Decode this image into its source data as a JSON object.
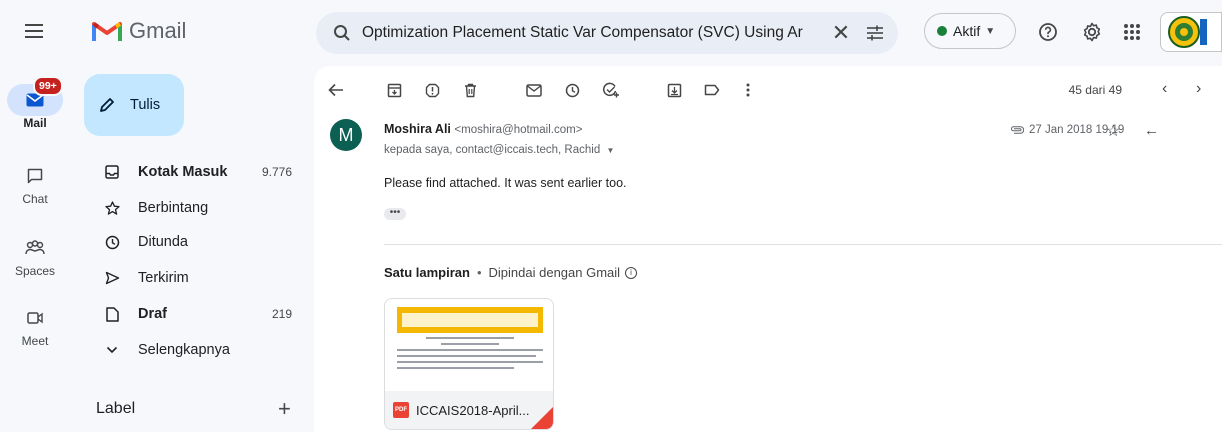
{
  "app": {
    "name": "Gmail",
    "brand_colors": [
      "#ea4335",
      "#4285f4",
      "#34a853",
      "#fbbc04",
      "#c5221f"
    ]
  },
  "search": {
    "value": "Optimization Placement Static Var Compensator (SVC) Using Ar",
    "clear_symbol": "✕"
  },
  "status": {
    "label": "Aktif",
    "color": "#188038"
  },
  "rail": {
    "items": [
      {
        "label": "Mail",
        "icon": "mail-icon",
        "badge": "99+",
        "active": true
      },
      {
        "label": "Chat",
        "icon": "chat-icon"
      },
      {
        "label": "Spaces",
        "icon": "spaces-icon"
      },
      {
        "label": "Meet",
        "icon": "meet-icon"
      }
    ]
  },
  "compose": {
    "label": "Tulis",
    "icon": "pencil-icon"
  },
  "sidebar": {
    "items": [
      {
        "label": "Kotak Masuk",
        "count": "9.776",
        "icon": "inbox-icon",
        "bold": true
      },
      {
        "label": "Berbintang",
        "count": "",
        "icon": "star-icon"
      },
      {
        "label": "Ditunda",
        "count": "",
        "icon": "clock-icon"
      },
      {
        "label": "Terkirim",
        "count": "",
        "icon": "send-icon"
      },
      {
        "label": "Draf",
        "count": "219",
        "icon": "draft-icon",
        "bold": true
      },
      {
        "label": "Selengkapnya",
        "count": "",
        "icon": "chevron-down-icon"
      }
    ],
    "labels_heading": "Label",
    "labels_add": "+"
  },
  "toolbar": {
    "icons": [
      "back-arrow-icon",
      "archive-icon",
      "report-spam-icon",
      "delete-icon",
      "mark-unread-icon",
      "snooze-icon",
      "add-task-icon",
      "move-to-icon",
      "label-icon",
      "more-vert-icon"
    ],
    "pager": "45 dari 49"
  },
  "email": {
    "avatar_letter": "M",
    "avatar_color": "#0b5f53",
    "sender_name": "Moshira Ali",
    "sender_email": "<moshira@hotmail.com>",
    "to": "kepada saya, contact@iccais.tech, Rachid",
    "date": "27 Jan 2018 19.19",
    "body": "Please find attached. It was sent earlier too.",
    "ellipsis": "•••"
  },
  "attachments": {
    "title": "Satu lampiran",
    "separator": "•",
    "note": "Dipindai dengan Gmail",
    "info_symbol": "i",
    "files": [
      {
        "name": "ICCAIS2018-April...",
        "type_badge": "PDF",
        "type": "pdf"
      }
    ]
  }
}
